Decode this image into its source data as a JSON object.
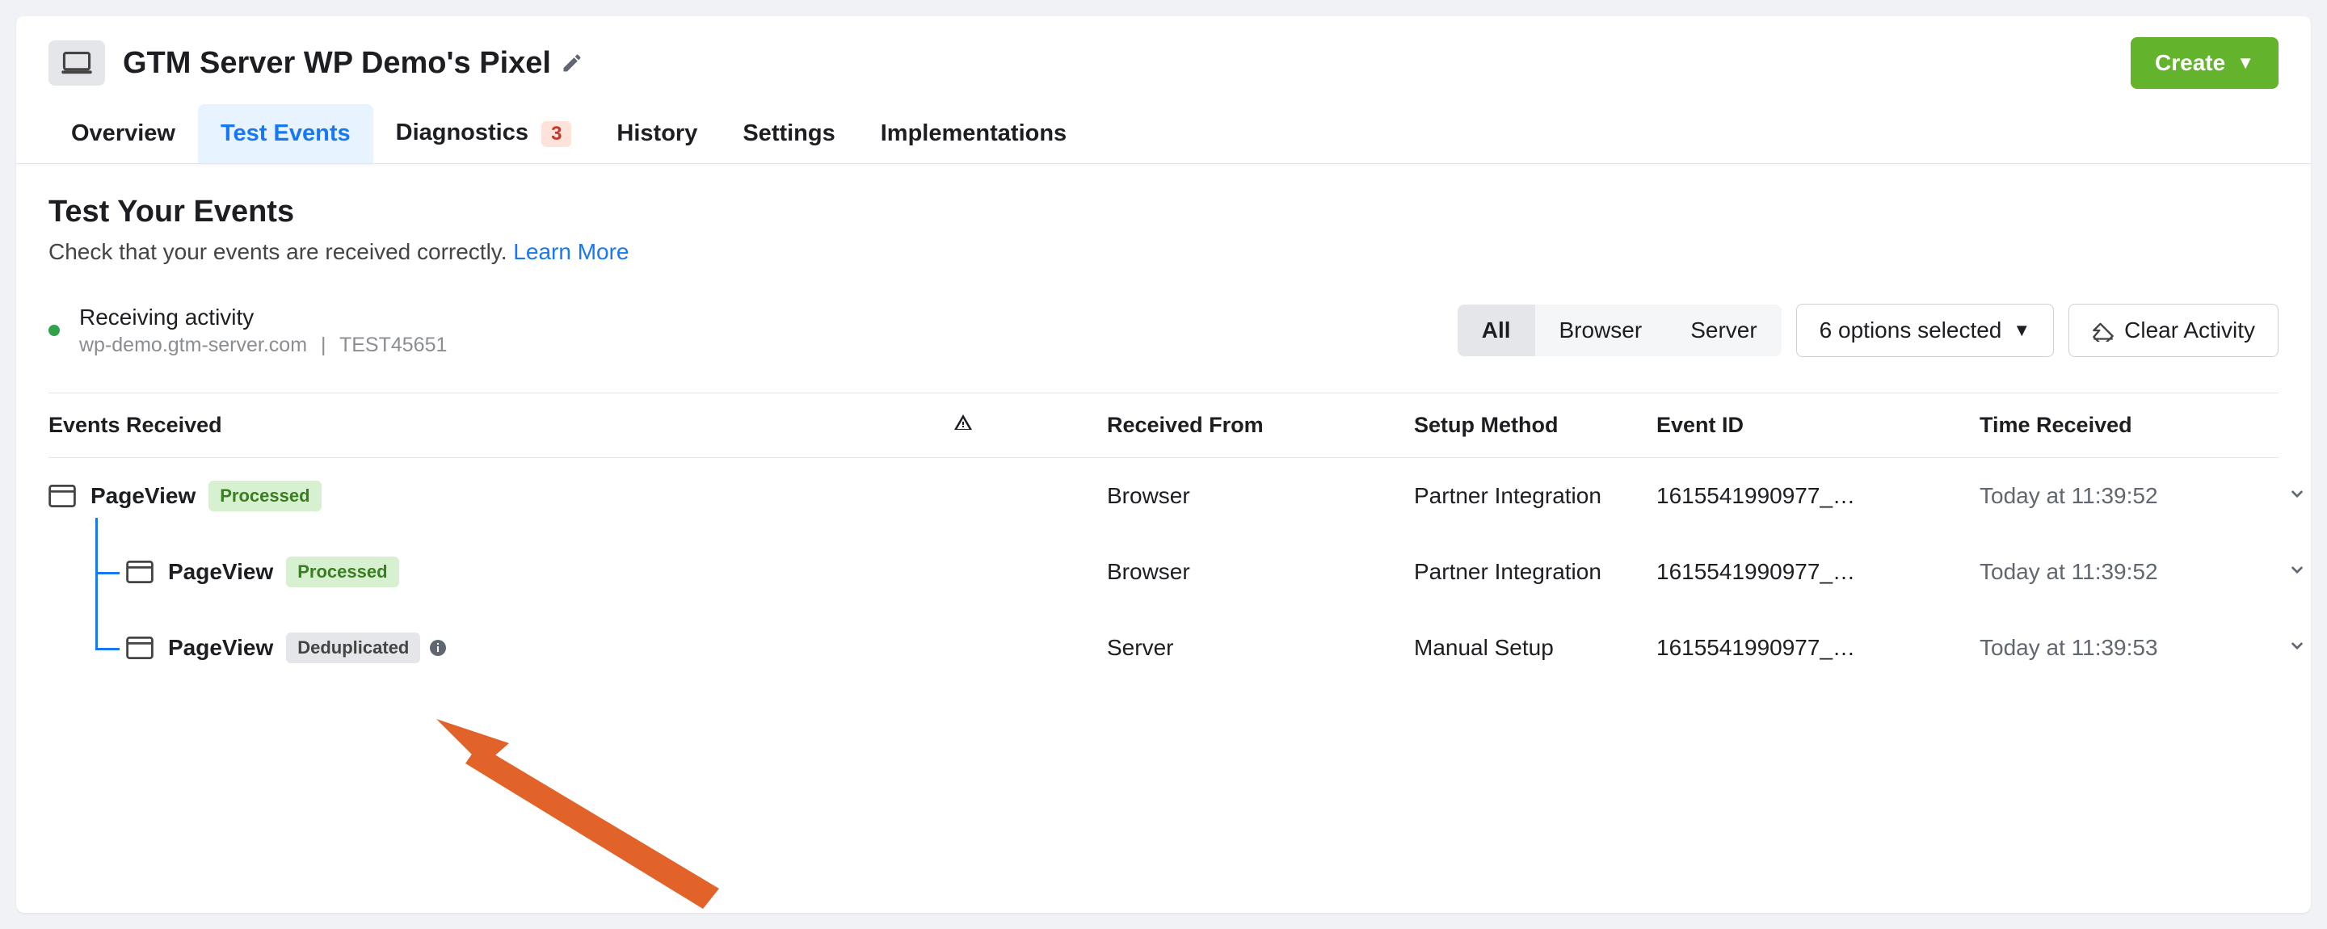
{
  "header": {
    "title": "GTM Server WP Demo's Pixel",
    "create_label": "Create"
  },
  "tabs": {
    "overview": "Overview",
    "test_events": "Test Events",
    "diagnostics": "Diagnostics",
    "diagnostics_badge": "3",
    "history": "History",
    "settings": "Settings",
    "implementations": "Implementations"
  },
  "page": {
    "title": "Test Your Events",
    "subtitle": "Check that your events are received correctly.",
    "learn_more": "Learn More"
  },
  "status": {
    "label": "Receiving activity",
    "domain": "wp-demo.gtm-server.com",
    "test_id": "TEST45651"
  },
  "controls": {
    "seg_all": "All",
    "seg_browser": "Browser",
    "seg_server": "Server",
    "options_label": "6 options selected",
    "clear_label": "Clear Activity"
  },
  "columns": {
    "events": "Events Received",
    "from": "Received From",
    "method": "Setup Method",
    "event_id": "Event ID",
    "time": "Time Received"
  },
  "rows": [
    {
      "name": "PageView",
      "status": "Processed",
      "status_type": "processed",
      "from": "Browser",
      "method": "Partner Integration",
      "event_id": "1615541990977_…",
      "time": "Today at 11:39:52",
      "indent": 0
    },
    {
      "name": "PageView",
      "status": "Processed",
      "status_type": "processed",
      "from": "Browser",
      "method": "Partner Integration",
      "event_id": "1615541990977_…",
      "time": "Today at 11:39:52",
      "indent": 1
    },
    {
      "name": "PageView",
      "status": "Deduplicated",
      "status_type": "deduplicated",
      "from": "Server",
      "method": "Manual Setup",
      "event_id": "1615541990977_…",
      "time": "Today at 11:39:53",
      "indent": 1
    }
  ]
}
